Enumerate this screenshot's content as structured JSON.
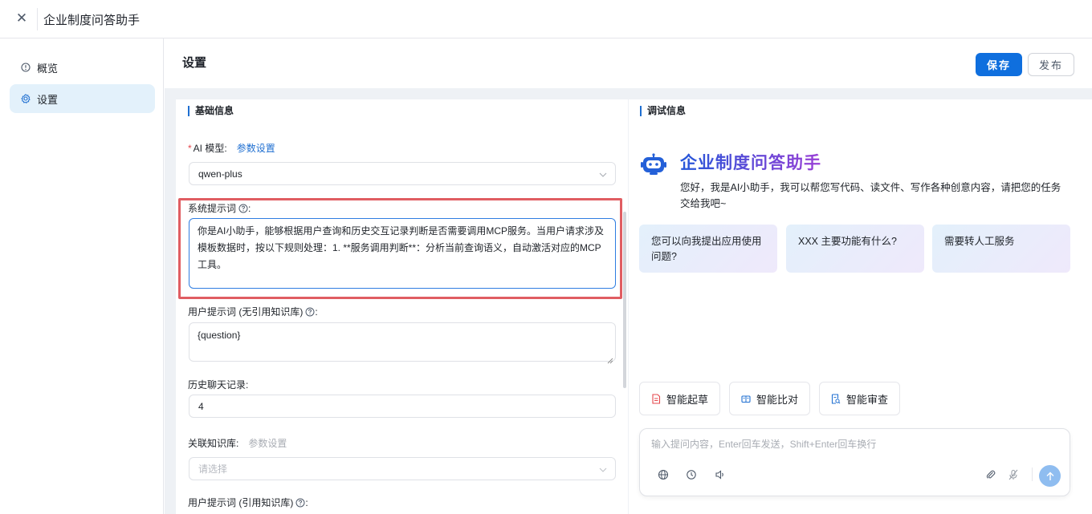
{
  "topbar": {
    "title": "企业制度问答助手"
  },
  "sidebar": {
    "items": [
      {
        "label": "概览",
        "icon": "info-circle-icon"
      },
      {
        "label": "设置",
        "icon": "gear-icon"
      }
    ]
  },
  "header": {
    "title": "设置",
    "save_label": "保存",
    "publish_label": "发布"
  },
  "basic": {
    "section_title": "基础信息",
    "model_label": "AI 模型:",
    "model_link": "参数设置",
    "model_value": "qwen-plus",
    "system_prompt_label": "系统提示词",
    "system_prompt_value": "你是AI小助手，能够根据用户查询和历史交互记录判断是否需要调用MCP服务。当用户请求涉及模板数据时，按以下规则处理：1. **服务调用判断**：分析当前查询语义，自动激活对应的MCP工具。",
    "user_prompt_label": "用户提示词 (无引用知识库)",
    "user_prompt_value": "{question}",
    "history_label": "历史聊天记录:",
    "history_value": "4",
    "kb_label": "关联知识库:",
    "kb_link": "参数设置",
    "kb_placeholder": "请选择",
    "user_prompt_kb_label": "用户提示词 (引用知识库)",
    "colon": ":"
  },
  "debug": {
    "section_title": "调试信息",
    "assistant_name": "企业制度问答助手",
    "greeting": "您好，我是AI小助手，我可以帮您写代码、读文件、写作各种创意内容，请把您的任务交给我吧~",
    "questions": [
      "您可以向我提出应用使用问题?",
      "XXX 主要功能有什么?",
      "需要转人工服务"
    ],
    "actions": [
      {
        "label": "智能起草",
        "icon": "document-icon",
        "color": "#e5484d"
      },
      {
        "label": "智能比对",
        "icon": "compare-book-icon",
        "color": "#1f6fd1"
      },
      {
        "label": "智能审查",
        "icon": "review-doc-icon",
        "color": "#1f6fd1"
      }
    ],
    "input_placeholder": "输入提问内容，Enter回车发送，Shift+Enter回车换行"
  },
  "colors": {
    "primary": "#0f6fde",
    "highlight": "#e05d62",
    "accent_gradient_start": "#2357d9",
    "accent_gradient_end": "#9a3fd6"
  }
}
